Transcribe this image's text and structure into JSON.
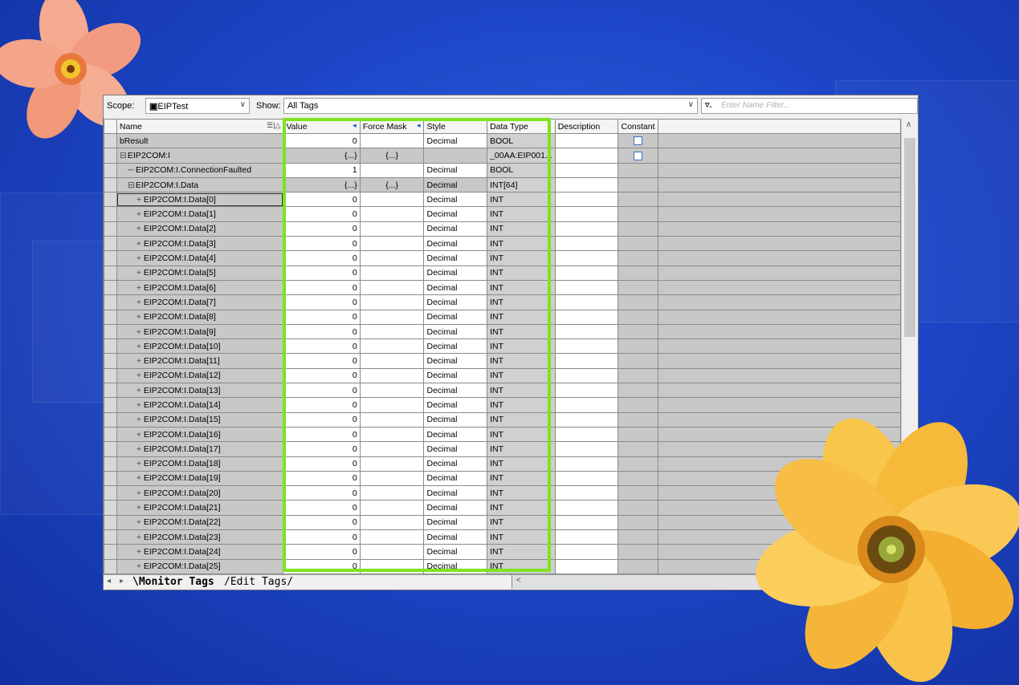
{
  "toolbar": {
    "scope_label": "Scope:",
    "scope_value": "EIPTest",
    "show_label": "Show:",
    "show_value": "All Tags",
    "filter_placeholder": "Enter Name Filter..."
  },
  "columns": {
    "name": "Name",
    "value": "Value",
    "force_mask": "Force Mask",
    "style": "Style",
    "data_type": "Data Type",
    "description": "Description",
    "constant": "Constant"
  },
  "rows": [
    {
      "name": "bResult",
      "indent": 0,
      "expander": "",
      "value": "0",
      "force": "",
      "style": "Decimal",
      "type": "BOOL",
      "constant": true,
      "kind": "plain"
    },
    {
      "name": "EIP2COM:I",
      "indent": 0,
      "expander": "⊟",
      "value": "{...}",
      "force": "{...}",
      "style": "",
      "type": "_00AA:EIP001...",
      "constant": true,
      "kind": "group"
    },
    {
      "name": "EIP2COM:I.ConnectionFaulted",
      "indent": 1,
      "expander": "",
      "value": "1",
      "force": "",
      "style": "Decimal",
      "type": "BOOL",
      "constant": false,
      "kind": "plain"
    },
    {
      "name": "EIP2COM:I.Data",
      "indent": 1,
      "expander": "⊟",
      "value": "{...}",
      "force": "{...}",
      "style": "Decimal",
      "type": "INT[64]",
      "constant": false,
      "kind": "group"
    },
    {
      "name": "EIP2COM:I.Data[0]",
      "indent": 2,
      "expander": "+",
      "value": "0",
      "force": "",
      "style": "Decimal",
      "type": "INT",
      "constant": false,
      "kind": "plain"
    },
    {
      "name": "EIP2COM:I.Data[1]",
      "indent": 2,
      "expander": "+",
      "value": "0",
      "force": "",
      "style": "Decimal",
      "type": "INT",
      "constant": false,
      "kind": "plain"
    },
    {
      "name": "EIP2COM:I.Data[2]",
      "indent": 2,
      "expander": "+",
      "value": "0",
      "force": "",
      "style": "Decimal",
      "type": "INT",
      "constant": false,
      "kind": "plain"
    },
    {
      "name": "EIP2COM:I.Data[3]",
      "indent": 2,
      "expander": "+",
      "value": "0",
      "force": "",
      "style": "Decimal",
      "type": "INT",
      "constant": false,
      "kind": "plain"
    },
    {
      "name": "EIP2COM:I.Data[4]",
      "indent": 2,
      "expander": "+",
      "value": "0",
      "force": "",
      "style": "Decimal",
      "type": "INT",
      "constant": false,
      "kind": "plain"
    },
    {
      "name": "EIP2COM:I.Data[5]",
      "indent": 2,
      "expander": "+",
      "value": "0",
      "force": "",
      "style": "Decimal",
      "type": "INT",
      "constant": false,
      "kind": "plain"
    },
    {
      "name": "EIP2COM:I.Data[6]",
      "indent": 2,
      "expander": "+",
      "value": "0",
      "force": "",
      "style": "Decimal",
      "type": "INT",
      "constant": false,
      "kind": "plain"
    },
    {
      "name": "EIP2COM:I.Data[7]",
      "indent": 2,
      "expander": "+",
      "value": "0",
      "force": "",
      "style": "Decimal",
      "type": "INT",
      "constant": false,
      "kind": "plain"
    },
    {
      "name": "EIP2COM:I.Data[8]",
      "indent": 2,
      "expander": "+",
      "value": "0",
      "force": "",
      "style": "Decimal",
      "type": "INT",
      "constant": false,
      "kind": "plain"
    },
    {
      "name": "EIP2COM:I.Data[9]",
      "indent": 2,
      "expander": "+",
      "value": "0",
      "force": "",
      "style": "Decimal",
      "type": "INT",
      "constant": false,
      "kind": "plain"
    },
    {
      "name": "EIP2COM:I.Data[10]",
      "indent": 2,
      "expander": "+",
      "value": "0",
      "force": "",
      "style": "Decimal",
      "type": "INT",
      "constant": false,
      "kind": "plain"
    },
    {
      "name": "EIP2COM:I.Data[11]",
      "indent": 2,
      "expander": "+",
      "value": "0",
      "force": "",
      "style": "Decimal",
      "type": "INT",
      "constant": false,
      "kind": "plain"
    },
    {
      "name": "EIP2COM:I.Data[12]",
      "indent": 2,
      "expander": "+",
      "value": "0",
      "force": "",
      "style": "Decimal",
      "type": "INT",
      "constant": false,
      "kind": "plain"
    },
    {
      "name": "EIP2COM:I.Data[13]",
      "indent": 2,
      "expander": "+",
      "value": "0",
      "force": "",
      "style": "Decimal",
      "type": "INT",
      "constant": false,
      "kind": "plain"
    },
    {
      "name": "EIP2COM:I.Data[14]",
      "indent": 2,
      "expander": "+",
      "value": "0",
      "force": "",
      "style": "Decimal",
      "type": "INT",
      "constant": false,
      "kind": "plain"
    },
    {
      "name": "EIP2COM:I.Data[15]",
      "indent": 2,
      "expander": "+",
      "value": "0",
      "force": "",
      "style": "Decimal",
      "type": "INT",
      "constant": false,
      "kind": "plain"
    },
    {
      "name": "EIP2COM:I.Data[16]",
      "indent": 2,
      "expander": "+",
      "value": "0",
      "force": "",
      "style": "Decimal",
      "type": "INT",
      "constant": false,
      "kind": "plain"
    },
    {
      "name": "EIP2COM:I.Data[17]",
      "indent": 2,
      "expander": "+",
      "value": "0",
      "force": "",
      "style": "Decimal",
      "type": "INT",
      "constant": false,
      "kind": "plain"
    },
    {
      "name": "EIP2COM:I.Data[18]",
      "indent": 2,
      "expander": "+",
      "value": "0",
      "force": "",
      "style": "Decimal",
      "type": "INT",
      "constant": false,
      "kind": "plain"
    },
    {
      "name": "EIP2COM:I.Data[19]",
      "indent": 2,
      "expander": "+",
      "value": "0",
      "force": "",
      "style": "Decimal",
      "type": "INT",
      "constant": false,
      "kind": "plain"
    },
    {
      "name": "EIP2COM:I.Data[20]",
      "indent": 2,
      "expander": "+",
      "value": "0",
      "force": "",
      "style": "Decimal",
      "type": "INT",
      "constant": false,
      "kind": "plain"
    },
    {
      "name": "EIP2COM:I.Data[21]",
      "indent": 2,
      "expander": "+",
      "value": "0",
      "force": "",
      "style": "Decimal",
      "type": "INT",
      "constant": false,
      "kind": "plain"
    },
    {
      "name": "EIP2COM:I.Data[22]",
      "indent": 2,
      "expander": "+",
      "value": "0",
      "force": "",
      "style": "Decimal",
      "type": "INT",
      "constant": false,
      "kind": "plain"
    },
    {
      "name": "EIP2COM:I.Data[23]",
      "indent": 2,
      "expander": "+",
      "value": "0",
      "force": "",
      "style": "Decimal",
      "type": "INT",
      "constant": false,
      "kind": "plain"
    },
    {
      "name": "EIP2COM:I.Data[24]",
      "indent": 2,
      "expander": "+",
      "value": "0",
      "force": "",
      "style": "Decimal",
      "type": "INT",
      "constant": false,
      "kind": "plain"
    },
    {
      "name": "EIP2COM:I.Data[25]",
      "indent": 2,
      "expander": "+",
      "value": "0",
      "force": "",
      "style": "Decimal",
      "type": "INT",
      "constant": false,
      "kind": "plain"
    }
  ],
  "selected_row": 4,
  "tabs": {
    "monitor": "Monitor Tags",
    "edit": "Edit Tags"
  },
  "colors": {
    "highlight": "#7fe31e",
    "desktop": "#1d47c8"
  }
}
